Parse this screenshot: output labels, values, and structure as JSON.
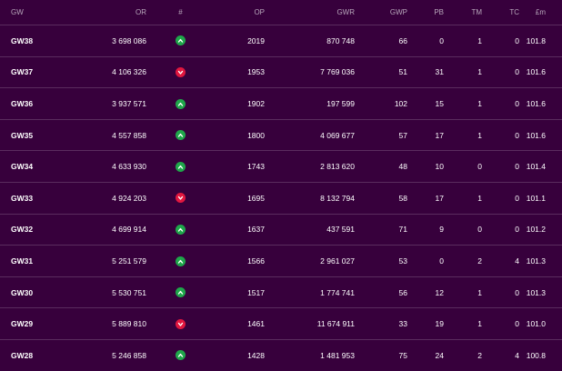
{
  "headers": [
    "GW",
    "OR",
    "#",
    "OP",
    "GWR",
    "GWP",
    "PB",
    "TM",
    "TC",
    "£m"
  ],
  "colors": {
    "up": "#1fa64a",
    "down": "#e0173f",
    "background": "#37003c"
  },
  "rows": [
    {
      "gw": "GW38",
      "or": "3 698 086",
      "move": "up",
      "op": "2019",
      "gwr": "870 748",
      "gwp": "66",
      "pb": "0",
      "tm": "1",
      "tc": "0",
      "value": "101.8"
    },
    {
      "gw": "GW37",
      "or": "4 106 326",
      "move": "down",
      "op": "1953",
      "gwr": "7 769 036",
      "gwp": "51",
      "pb": "31",
      "tm": "1",
      "tc": "0",
      "value": "101.6"
    },
    {
      "gw": "GW36",
      "or": "3 937 571",
      "move": "up",
      "op": "1902",
      "gwr": "197 599",
      "gwp": "102",
      "pb": "15",
      "tm": "1",
      "tc": "0",
      "value": "101.6"
    },
    {
      "gw": "GW35",
      "or": "4 557 858",
      "move": "up",
      "op": "1800",
      "gwr": "4 069 677",
      "gwp": "57",
      "pb": "17",
      "tm": "1",
      "tc": "0",
      "value": "101.6"
    },
    {
      "gw": "GW34",
      "or": "4 633 930",
      "move": "up",
      "op": "1743",
      "gwr": "2 813 620",
      "gwp": "48",
      "pb": "10",
      "tm": "0",
      "tc": "0",
      "value": "101.4"
    },
    {
      "gw": "GW33",
      "or": "4 924 203",
      "move": "down",
      "op": "1695",
      "gwr": "8 132 794",
      "gwp": "58",
      "pb": "17",
      "tm": "1",
      "tc": "0",
      "value": "101.1"
    },
    {
      "gw": "GW32",
      "or": "4 699 914",
      "move": "up",
      "op": "1637",
      "gwr": "437 591",
      "gwp": "71",
      "pb": "9",
      "tm": "0",
      "tc": "0",
      "value": "101.2"
    },
    {
      "gw": "GW31",
      "or": "5 251 579",
      "move": "up",
      "op": "1566",
      "gwr": "2 961 027",
      "gwp": "53",
      "pb": "0",
      "tm": "2",
      "tc": "4",
      "value": "101.3"
    },
    {
      "gw": "GW30",
      "or": "5 530 751",
      "move": "up",
      "op": "1517",
      "gwr": "1 774 741",
      "gwp": "56",
      "pb": "12",
      "tm": "1",
      "tc": "0",
      "value": "101.3"
    },
    {
      "gw": "GW29",
      "or": "5 889 810",
      "move": "down",
      "op": "1461",
      "gwr": "11 674 911",
      "gwp": "33",
      "pb": "19",
      "tm": "1",
      "tc": "0",
      "value": "101.0"
    },
    {
      "gw": "GW28",
      "or": "5 246 858",
      "move": "up",
      "op": "1428",
      "gwr": "1 481 953",
      "gwp": "75",
      "pb": "24",
      "tm": "2",
      "tc": "4",
      "value": "100.8"
    }
  ]
}
